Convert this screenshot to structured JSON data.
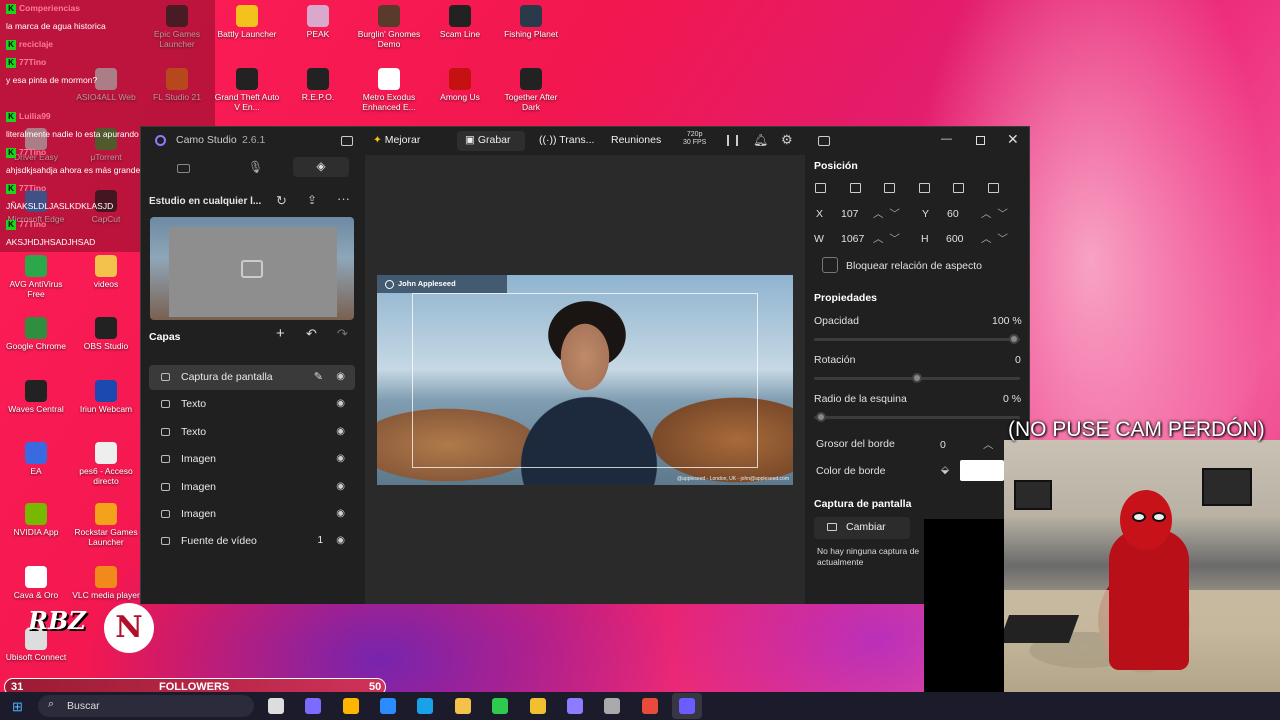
{
  "desktop_icons": [
    {
      "label": "Epic Games Launcher",
      "color": "#2a2a2a"
    },
    {
      "label": "Battly Launcher",
      "color": "#f4c21c"
    },
    {
      "label": "PEAK",
      "color": "#d9a8cc"
    },
    {
      "label": "Burglin' Gnomes Demo",
      "color": "#5a3a2a"
    },
    {
      "label": "Scam Line",
      "color": "#222"
    },
    {
      "label": "Fishing Planet",
      "color": "#2a3a4a"
    },
    {
      "label": "FL Studio 21",
      "color": "#f07a1a"
    },
    {
      "label": "Grand Theft Auto V En...",
      "color": "#222"
    },
    {
      "label": "R.E.P.O.",
      "color": "#222"
    },
    {
      "label": "Metro Exodus Enhanced E...",
      "color": "#fff"
    },
    {
      "label": "Among Us",
      "color": "#c51111"
    },
    {
      "label": "Together After Dark",
      "color": "#222"
    },
    {
      "label": "μTorrent",
      "color": "#3a9a3a"
    },
    {
      "label": "Microsoft Edge",
      "color": "#1a8adf"
    },
    {
      "label": "CapCut",
      "color": "#222"
    },
    {
      "label": "AVG AntiVirus Free",
      "color": "#2aa84a"
    },
    {
      "label": "videos",
      "color": "#f2c24a"
    },
    {
      "label": "Google Chrome",
      "color": "#2f8f3f"
    },
    {
      "label": "OBS Studio",
      "color": "#222"
    },
    {
      "label": "Waves Central",
      "color": "#222"
    },
    {
      "label": "Iriun Webcam",
      "color": "#1a4aaf"
    },
    {
      "label": "EA",
      "color": "#3a6adf"
    },
    {
      "label": "pes6 - Acceso directo",
      "color": "#eee"
    },
    {
      "label": "NVIDIA App",
      "color": "#76b900"
    },
    {
      "label": "Rockstar Games Launcher",
      "color": "#f4a21c"
    },
    {
      "label": "Cava & Oro",
      "color": "#fff"
    },
    {
      "label": "VLC media player",
      "color": "#f08a1a"
    },
    {
      "label": "Ubisoft Connect",
      "color": "#ddd"
    },
    {
      "label": "ASIO4ALL Web",
      "color": "#ddd"
    },
    {
      "label": "Driver Easy",
      "color": "#ddd"
    }
  ],
  "chat": [
    {
      "user": "Comperiencias",
      "text": ""
    },
    {
      "user": "",
      "text": "la marca de agua historica"
    },
    {
      "user": "reciclaje",
      "text": ""
    },
    {
      "user": "77Tino",
      "text": ""
    },
    {
      "user": "",
      "text": "y esa pinta de mormon?"
    },
    {
      "user": "",
      "text": ""
    },
    {
      "user": "Luilia99",
      "text": ""
    },
    {
      "user": "",
      "text": "literalmente nadie lo esta apurando"
    },
    {
      "user": "77Tino",
      "text": ""
    },
    {
      "user": "",
      "text": "ahjsdkjsahdja ahora es más grande"
    },
    {
      "user": "77Tino",
      "text": ""
    },
    {
      "user": "",
      "text": "JÑAKSLDLJASLKDKLASJD"
    },
    {
      "user": "77Tino",
      "text": ""
    },
    {
      "user": "",
      "text": "AKSJHDJHSADJHSAD"
    }
  ],
  "app": {
    "title": "Camo Studio",
    "version": "2.6.1",
    "mejorar": "Mejorar",
    "grabar": "Grabar",
    "transmitir": "Trans...",
    "reuniones": "Reuniones",
    "res_top": "720p",
    "res_bottom": "30 FPS"
  },
  "left_panel": {
    "studio_title": "Estudio en cualquier l...",
    "layers_title": "Capas",
    "layers": [
      {
        "label": "Captura de pantalla",
        "selected": true
      },
      {
        "label": "Texto",
        "selected": false
      },
      {
        "label": "Texto",
        "selected": false
      },
      {
        "label": "Imagen",
        "selected": false
      },
      {
        "label": "Imagen",
        "selected": false
      },
      {
        "label": "Imagen",
        "selected": false
      },
      {
        "label": "Fuente de vídeo",
        "selected": false,
        "badge": "1"
      }
    ]
  },
  "preview": {
    "name": "John Appleseed",
    "footer": "@appleseed - London, UK - john@appleseed.com"
  },
  "right_panel": {
    "posicion": "Posición",
    "x_label": "X",
    "x_value": "107",
    "y_label": "Y",
    "y_value": "60",
    "w_label": "W",
    "w_value": "1067",
    "h_label": "H",
    "h_value": "600",
    "lock_aspect": "Bloquear relación de aspecto",
    "propiedades": "Propiedades",
    "opacidad": "Opacidad",
    "opacidad_value": "100 %",
    "rotacion": "Rotación",
    "rotacion_value": "0",
    "radio": "Radio de la esquina",
    "radio_value": "0 %",
    "grosor": "Grosor del borde",
    "grosor_value": "0",
    "color_borde": "Color de borde",
    "captura": "Captura de pantalla",
    "cambiar": "Cambiar",
    "no_captura": "No hay ninguna captura de actualmente"
  },
  "overlay": {
    "caption": "(NO PUSE CAM PERDÓN)"
  },
  "followers": {
    "current": "31",
    "label": "FOLLOWERS",
    "goal": "50",
    "progress": 0.62
  },
  "taskbar": {
    "search": "Buscar"
  }
}
